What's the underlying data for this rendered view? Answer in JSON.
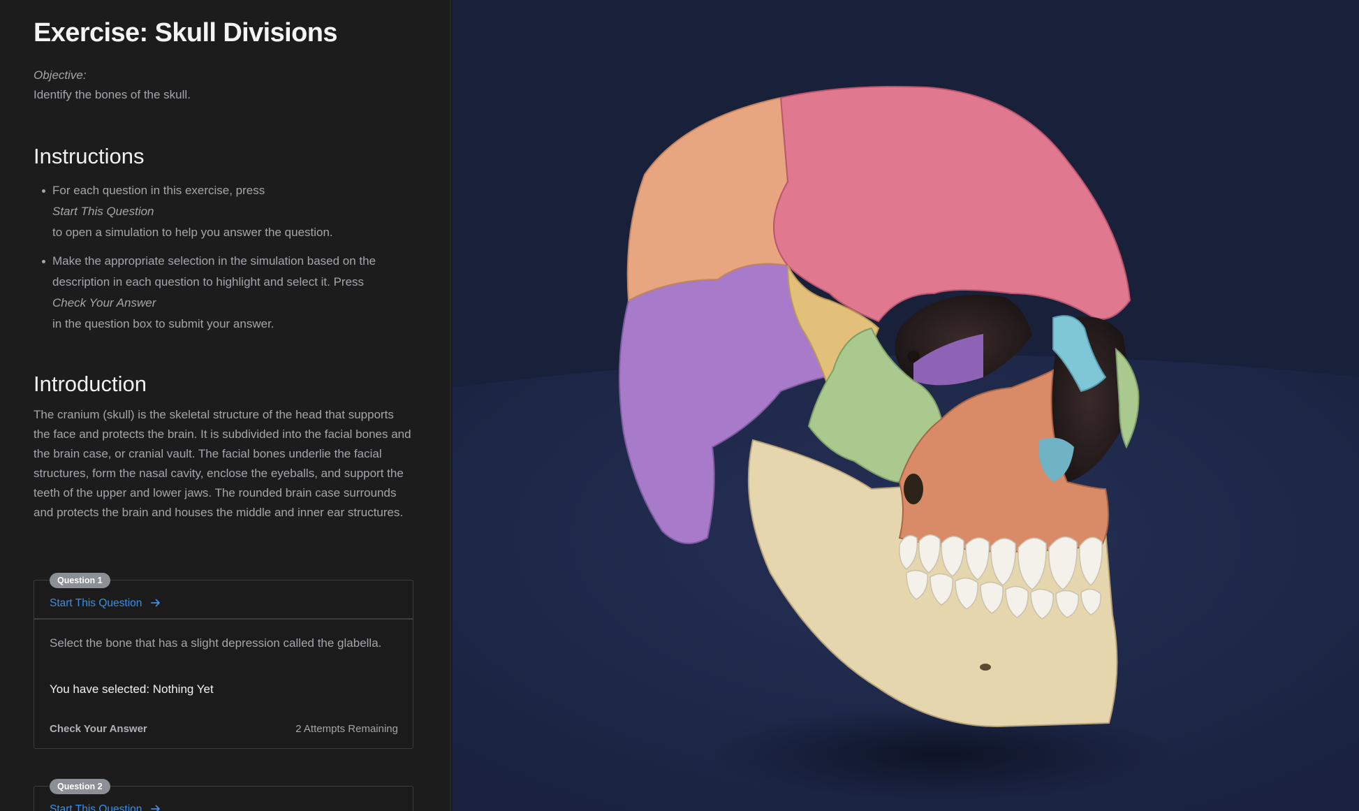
{
  "exercise": {
    "title": "Exercise: Skull Divisions",
    "objective_label": "Objective:",
    "objective_text": "Identify the bones of the skull."
  },
  "instructions": {
    "heading": "Instructions",
    "items": [
      {
        "before": "For each question in this exercise, press",
        "emphasis": "Start This Question",
        "after": "to open a simulation to help you answer the question."
      },
      {
        "before": "Make the appropriate selection in the simulation based on the description in each question to highlight and select it. Press",
        "emphasis": "Check Your Answer",
        "after": "in the question box to submit your answer."
      }
    ]
  },
  "introduction": {
    "heading": "Introduction",
    "text": "The cranium (skull) is the skeletal structure of the head that supports the face and protects the brain. It is subdivided into the facial bones and the brain case, or cranial vault. The facial bones underlie the facial structures, form the nasal cavity, enclose the eyeballs, and support the teeth of the upper and lower jaws. The rounded brain case surrounds and protects the brain and houses the middle and inner ear structures."
  },
  "questions": [
    {
      "badge": "Question 1",
      "start_label": "Start This Question",
      "prompt": "Select the bone that has a slight depression called the glabella.",
      "selected_text": "You have selected: Nothing Yet",
      "check_label": "Check Your Answer",
      "attempts_text": "2 Attempts Remaining"
    },
    {
      "badge": "Question 2",
      "start_label": "Start This Question"
    }
  ],
  "viewer": {
    "background": "#18203a",
    "floor_color": "#1d2742",
    "bone_colors": {
      "frontal": "#e0788f",
      "parietal": "#e7a67f",
      "temporal": "#a77bc9",
      "sphenoid": "#e2c07a",
      "zygomatic": "#a9c98f",
      "maxilla": "#d98a66",
      "nasal": "#7fc6d6",
      "mandible": "#e6d6ad",
      "teeth": "#f3f1ea"
    }
  },
  "colors": {
    "panel_bg": "#1c1c1d",
    "link": "#3b8fe6",
    "badge_bg": "#8b8f96",
    "text_muted": "#a5a6aa",
    "text_strong": "#f4f4f5"
  }
}
